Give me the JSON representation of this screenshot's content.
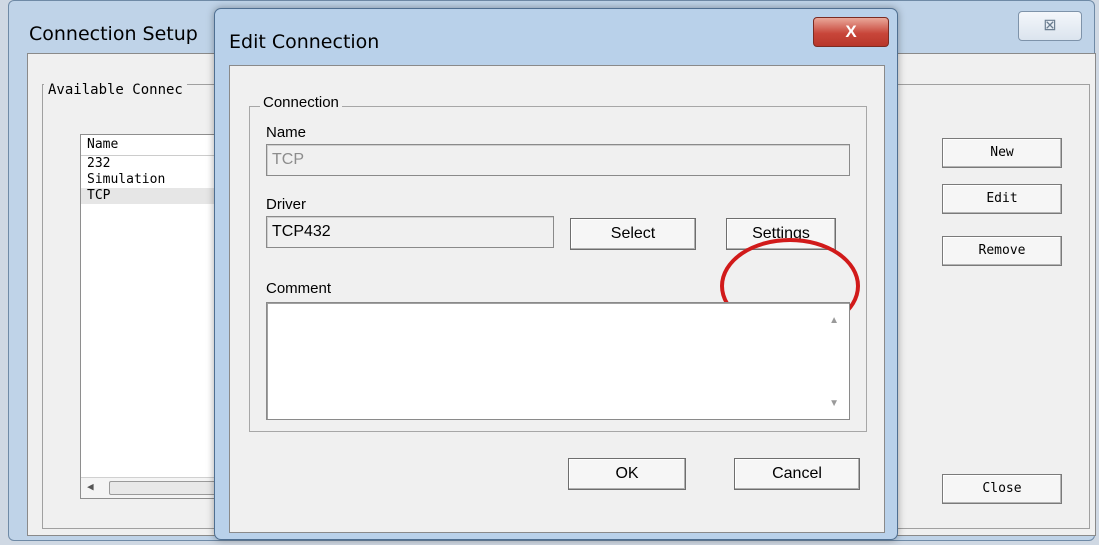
{
  "background_window": {
    "title": "Connection Setup",
    "close_glyph": "⊠",
    "group_label": "Available Connec",
    "list": {
      "header": "Name",
      "items": [
        "232",
        "Simulation",
        "TCP"
      ],
      "selected": "TCP"
    },
    "buttons": {
      "new": "New",
      "edit": "Edit",
      "remove": "Remove",
      "close": "Close"
    }
  },
  "dialog": {
    "title": "Edit Connection",
    "close_glyph": "X",
    "group_label": "Connection",
    "name_label": "Name",
    "name_value": "TCP",
    "driver_label": "Driver",
    "driver_value": "TCP432",
    "select_button": "Select",
    "settings_button": "Settings",
    "comment_label": "Comment",
    "comment_value": "",
    "ok_button": "OK",
    "cancel_button": "Cancel"
  },
  "colors": {
    "highlight": "#d11a1a",
    "close_button": "#c8463a",
    "frame": "#b9d1ea"
  }
}
